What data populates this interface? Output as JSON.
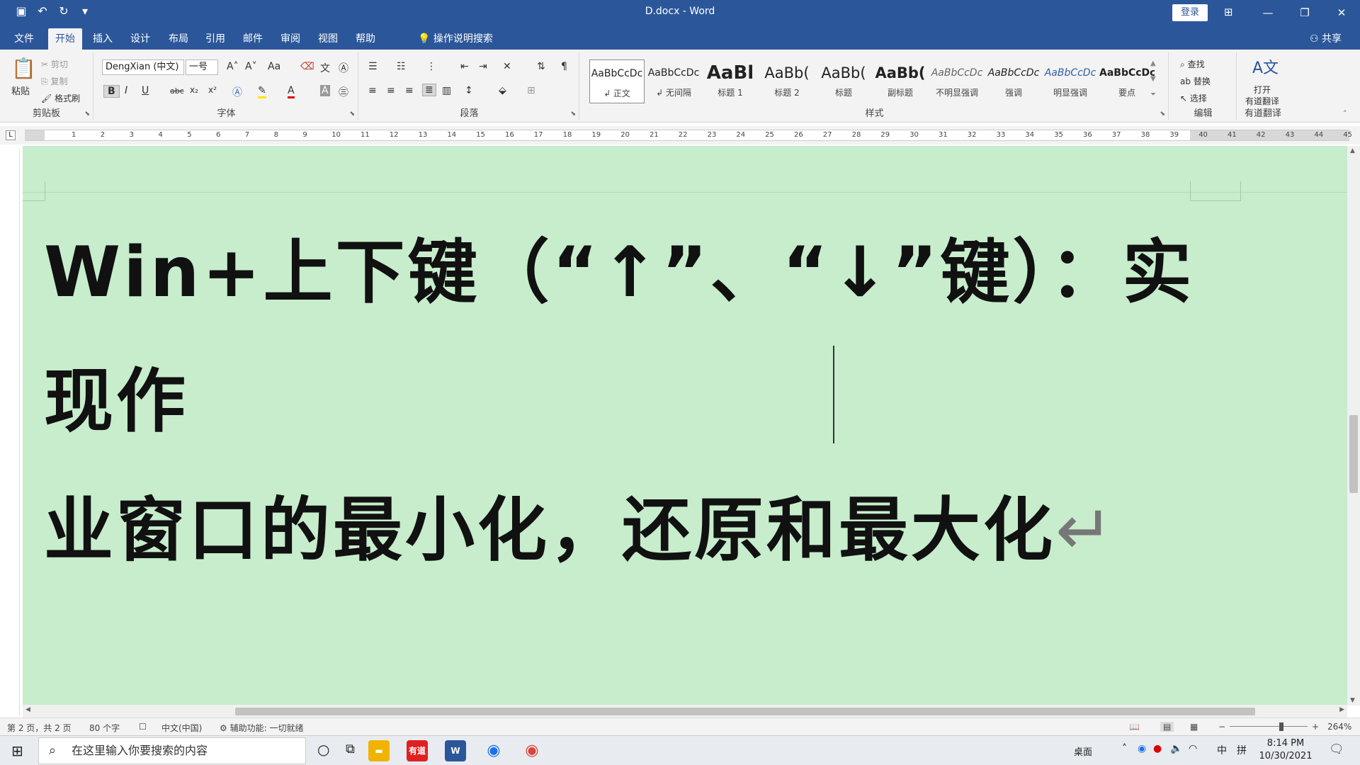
{
  "window": {
    "title": "D.docx  -  Word",
    "login_label": "登录"
  },
  "tabs": [
    {
      "label": "文件"
    },
    {
      "label": "开始"
    },
    {
      "label": "插入"
    },
    {
      "label": "设计"
    },
    {
      "label": "布局"
    },
    {
      "label": "引用"
    },
    {
      "label": "邮件"
    },
    {
      "label": "审阅"
    },
    {
      "label": "视图"
    },
    {
      "label": "帮助"
    }
  ],
  "tell_me": "操作说明搜索",
  "share": "共享",
  "clipboard": {
    "paste": "粘贴",
    "cut": "剪切",
    "copy": "复制",
    "format_painter": "格式刷",
    "label": "剪贴板"
  },
  "font": {
    "name": "DengXian (中文)",
    "size": "一号",
    "case": "Aa",
    "label": "字体",
    "bold": "B",
    "italic": "I",
    "underline": "U",
    "strike": "abc",
    "subscript": "x₂",
    "superscript": "x²"
  },
  "paragraph": {
    "label": "段落"
  },
  "styles": {
    "label": "样式",
    "items": [
      {
        "preview": "AaBbCcDc",
        "name": "↲ 正文"
      },
      {
        "preview": "AaBbCcDc",
        "name": "↲ 无间隔"
      },
      {
        "preview": "AaBl",
        "name": "标题 1"
      },
      {
        "preview": "AaBb(",
        "name": "标题 2"
      },
      {
        "preview": "AaBb(",
        "name": "标题"
      },
      {
        "preview": "AaBb(",
        "name": "副标题"
      },
      {
        "preview": "AaBbCcDc",
        "name": "不明显强调"
      },
      {
        "preview": "AaBbCcDc",
        "name": "强调"
      },
      {
        "preview": "AaBbCcDc",
        "name": "明显强调"
      },
      {
        "preview": "AaBbCcDc",
        "name": "要点"
      }
    ]
  },
  "editing": {
    "find": "查找",
    "replace": "替换",
    "select": "选择",
    "label": "编辑"
  },
  "translate": {
    "open": "打开",
    "name": "有道翻译",
    "label": "有道翻译"
  },
  "ruler": {
    "numbers": [
      "1",
      "2",
      "3",
      "4",
      "5",
      "6",
      "7",
      "8",
      "9",
      "10",
      "11",
      "12",
      "13",
      "14",
      "15",
      "16",
      "17",
      "18",
      "19",
      "20",
      "21",
      "22",
      "23",
      "24",
      "25",
      "26",
      "27",
      "28",
      "29",
      "30",
      "31",
      "32",
      "33",
      "34",
      "35",
      "36",
      "37",
      "38",
      "39",
      "40",
      "41",
      "42",
      "43",
      "44",
      "45"
    ]
  },
  "document": {
    "line1": "Win+上下键（“↑”、“↓”键）：实现作",
    "line2_before_cursor": "业窗口的最小化，还原和",
    "line2_after_cursor": "最大化",
    "paragraph_mark": "↵"
  },
  "status": {
    "page": "第 2 页，共 2 页",
    "words": "80 个字",
    "language": "中文(中国)",
    "accessibility": "辅助功能: 一切就绪",
    "zoom": "264%"
  },
  "taskbar": {
    "search_placeholder": "在这里输入你要搜索的内容",
    "desktop": "桌面",
    "ime_lang": "中",
    "ime_mode": "拼",
    "time": "8:14 PM",
    "date": "10/30/2021",
    "youdao_label": "有道",
    "word_label": "W"
  },
  "colors": {
    "word_blue": "#2b579a",
    "doc_background": "#c7edcc"
  }
}
